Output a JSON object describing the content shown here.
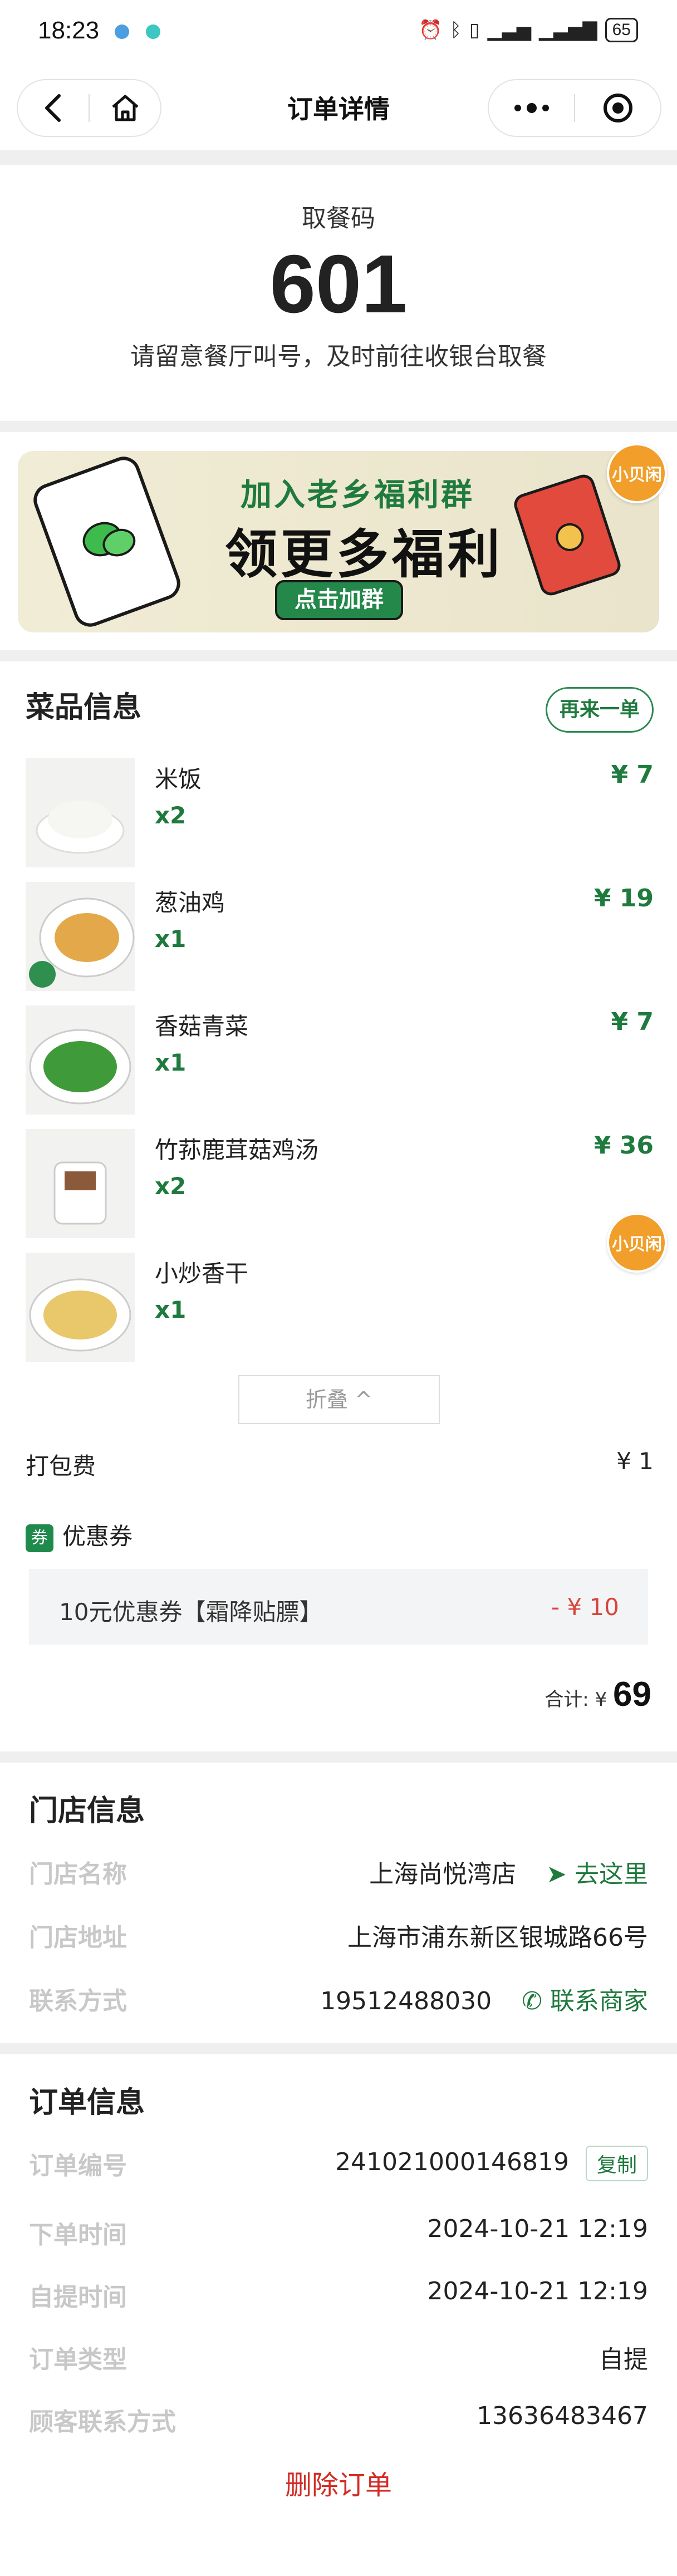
{
  "status_bar": {
    "time": "18:23",
    "battery": "65",
    "icons": [
      "alarm-icon",
      "bluetooth-icon",
      "vibrate-icon",
      "signal-icon",
      "signal-icon",
      "battery-icon"
    ]
  },
  "nav": {
    "title": "订单详情",
    "left_icons": [
      "back-icon",
      "home-icon"
    ],
    "right_icons": [
      "more-icon",
      "target-icon"
    ]
  },
  "pickup": {
    "label": "取餐码",
    "code": "601",
    "note": "请留意餐厅叫号，及时前往收银台取餐"
  },
  "banner": {
    "line1": "加入老乡福利群",
    "line2": "领更多福利",
    "button": "点击加群",
    "float_badge": "小贝闲"
  },
  "dishes": {
    "title": "菜品信息",
    "reorder": "再来一单",
    "items": [
      {
        "name": "米饭",
        "qty": "x2",
        "price": "¥ 7"
      },
      {
        "name": "葱油鸡",
        "qty": "x1",
        "price": "¥ 19"
      },
      {
        "name": "香菇青菜",
        "qty": "x1",
        "price": "¥ 7"
      },
      {
        "name": "竹荪鹿茸菇鸡汤",
        "qty": "x2",
        "price": "¥ 36"
      },
      {
        "name": "小炒香干",
        "qty": "x1",
        "price": ""
      }
    ],
    "fold": "折叠 ^",
    "packing_label": "打包费",
    "packing_value": "¥ 1",
    "coupon_icon": "券",
    "coupon_label": "优惠券",
    "coupon_name": "10元优惠券【霜降贴膘】",
    "coupon_amount": "- ¥ 10",
    "total_label": "合计: ¥",
    "total_value": "69"
  },
  "store": {
    "title": "门店信息",
    "rows": [
      {
        "key": "门店名称",
        "value": "上海尚悦湾店",
        "action": "去这里"
      },
      {
        "key": "门店地址",
        "value": "上海市浦东新区银城路66号",
        "action": ""
      },
      {
        "key": "联系方式",
        "value": "19512488030",
        "action": "联系商家"
      }
    ]
  },
  "order": {
    "title": "订单信息",
    "rows": [
      {
        "key": "订单编号",
        "value": "241021000146819",
        "action": "复制"
      },
      {
        "key": "下单时间",
        "value": "2024-10-21 12:19"
      },
      {
        "key": "自提时间",
        "value": "2024-10-21 12:19"
      },
      {
        "key": "订单类型",
        "value": "自提"
      },
      {
        "key": "顾客联系方式",
        "value": "13636483467"
      }
    ],
    "delete": "删除订单"
  },
  "colors": {
    "brand_green": "#1f7a3e",
    "price_red": "#d8443c",
    "delete_red": "#d22b25"
  }
}
